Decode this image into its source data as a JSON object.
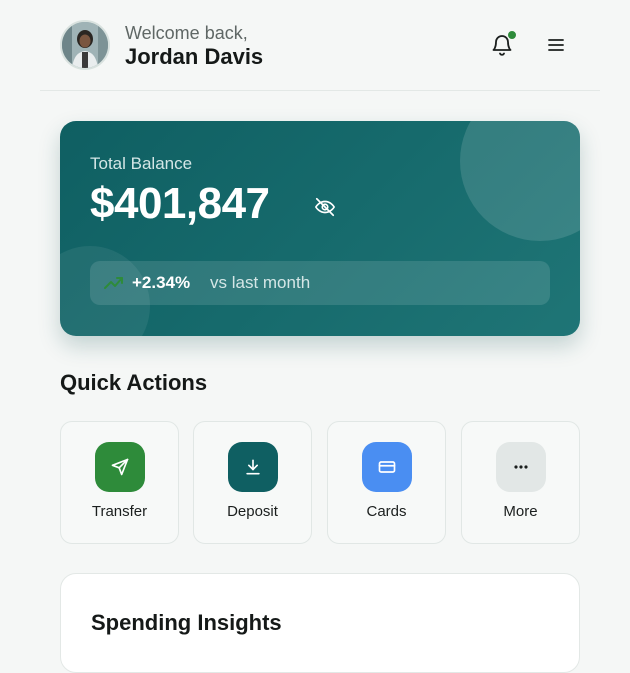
{
  "header": {
    "greeting": "Welcome back,",
    "user_name": "Jordan Davis",
    "avatar_icon": "user-photo",
    "notification_icon": "bell-icon",
    "notification_dot_color": "#2e8b3a",
    "menu_icon": "hamburger-menu-icon"
  },
  "balance": {
    "label": "Total Balance",
    "amount": "$401,847",
    "visibility_icon": "eye-off-icon",
    "change": "+2.34%",
    "change_text": "vs last month",
    "trend_icon": "trending-up-icon",
    "trend_color": "#2e8b3a"
  },
  "quick_actions": {
    "title": "Quick Actions",
    "items": [
      {
        "label": "Transfer",
        "icon": "send-icon",
        "color": "#2e8b3a"
      },
      {
        "label": "Deposit",
        "icon": "download-icon",
        "color": "#0f5f62"
      },
      {
        "label": "Cards",
        "icon": "card-icon",
        "color": "#4a8ef2"
      },
      {
        "label": "More",
        "icon": "more-icon",
        "color": "#e2e7e6"
      }
    ]
  },
  "insights": {
    "title": "Spending Insights"
  }
}
